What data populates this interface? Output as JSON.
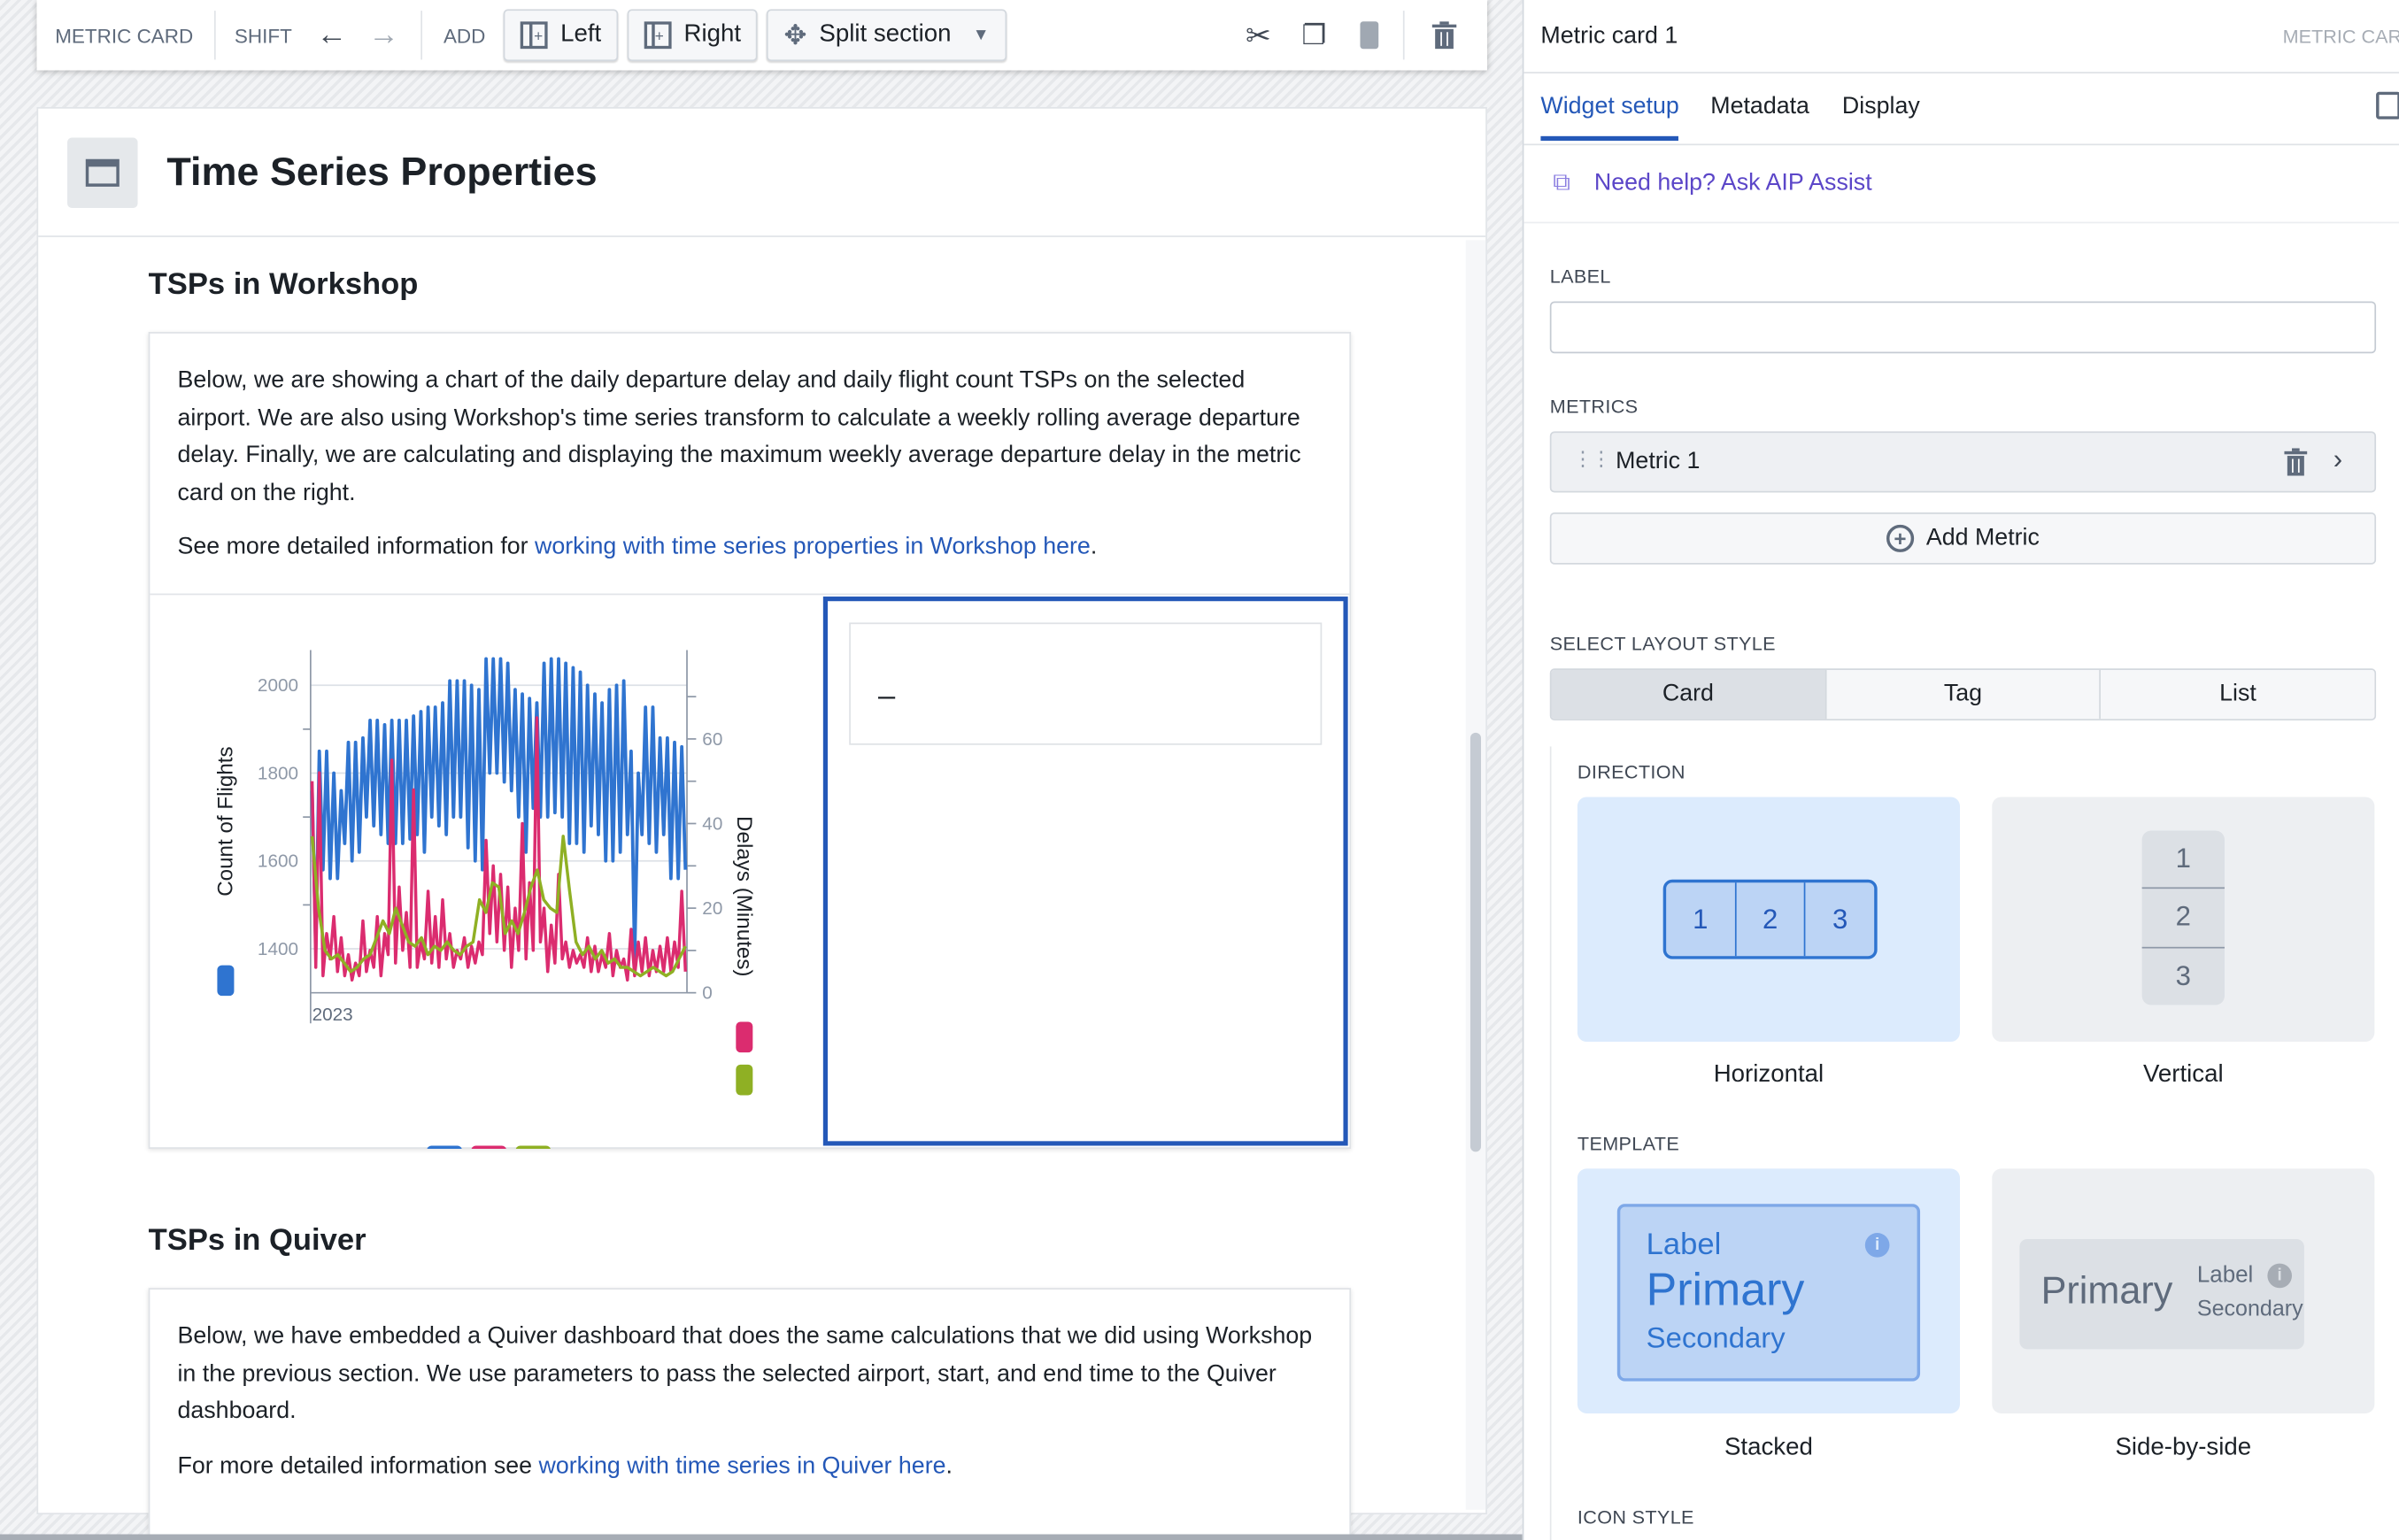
{
  "toolbar": {
    "widget_type": "METRIC CARD",
    "shift_label": "SHIFT",
    "add_label": "ADD",
    "left_label": "Left",
    "right_label": "Right",
    "split_label": "Split section",
    "icons": [
      "arrow-left-icon",
      "arrow-right-icon",
      "cut-icon",
      "duplicate-icon",
      "clipboard-icon",
      "trash-icon"
    ]
  },
  "page": {
    "title": "Time Series Properties"
  },
  "section1": {
    "heading": "TSPs in Workshop",
    "p1": "Below, we are showing a chart of the daily departure delay and daily flight count TSPs on the selected airport. We are also using Workshop's time series transform to calculate a weekly rolling average departure delay. Finally, we are calculating and displaying the maximum weekly average departure delay in the metric card on the right.",
    "p2_prefix": "See more detailed information for ",
    "p2_link": "working with time series properties in Workshop here",
    "p2_suffix": ".",
    "metric_value": "–"
  },
  "section2": {
    "heading": "TSPs in Quiver",
    "p1": "Below, we have embedded a Quiver dashboard that does the same calculations that we did using Workshop in the previous section. We use parameters to pass the selected airport, start, and end time to the Quiver dashboard.",
    "p2_prefix": "For more detailed information see ",
    "p2_link": "working with time series in Quiver here",
    "p2_suffix": "."
  },
  "chart_data": {
    "type": "line",
    "x_label": "2023",
    "ylabel": "Count of Flights",
    "ylim": [
      1300,
      2080
    ],
    "yticks": [
      1400,
      1600,
      1800,
      2000
    ],
    "y2label": "Delays (Minutes)",
    "y2lim": [
      0,
      81
    ],
    "y2ticks": [
      0,
      20,
      40,
      60
    ],
    "grid": true,
    "legend": "bottom",
    "series": [
      {
        "axis": "left",
        "color": "#2f74d0",
        "values": [
          1760,
          1400,
          1850,
          1580,
          1850,
          1560,
          1800,
          1560,
          1760,
          1640,
          1870,
          1600,
          1870,
          1620,
          1880,
          1700,
          1920,
          1680,
          1920,
          1660,
          1910,
          1640,
          1920,
          1640,
          1920,
          1640,
          1920,
          1650,
          1930,
          1660,
          1940,
          1620,
          1950,
          1700,
          1950,
          1680,
          1960,
          1660,
          2010,
          1700,
          2010,
          1700,
          2010,
          1630,
          2000,
          1600,
          1990,
          1580,
          2060,
          1800,
          2060,
          1800,
          2060,
          1780,
          2050,
          1760,
          1990,
          1700,
          1980,
          1620,
          1970,
          1720,
          1960,
          1700,
          2050,
          1700,
          2060,
          1710,
          2060,
          1700,
          2050,
          1640,
          2040,
          1640,
          2030,
          1620,
          2000,
          1680,
          1980,
          1660,
          1960,
          1600,
          1990,
          1600,
          2000,
          1620,
          2010,
          1660,
          1850,
          1380,
          1800,
          1660,
          1950,
          1640,
          1950,
          1620,
          1880,
          1660,
          1880,
          1560,
          1870,
          1560,
          1860,
          1580
        ]
      },
      {
        "axis": "right",
        "color": "#db2c6f",
        "values": [
          50,
          6,
          52,
          4,
          14,
          8,
          18,
          5,
          13,
          4,
          9,
          3,
          7,
          4,
          17,
          5,
          10,
          6,
          18,
          4,
          14,
          9,
          55,
          7,
          25,
          10,
          19,
          6,
          48,
          6,
          12,
          8,
          24,
          7,
          18,
          6,
          22,
          8,
          14,
          6,
          10,
          8,
          13,
          6,
          11,
          7,
          12,
          9,
          36,
          14,
          30,
          12,
          28,
          10,
          25,
          6,
          20,
          10,
          40,
          8,
          26,
          10,
          65,
          12,
          20,
          5,
          16,
          7,
          28,
          8,
          12,
          6,
          10,
          7,
          9,
          6,
          13,
          5,
          11,
          5,
          9,
          6,
          14,
          4,
          10,
          6,
          8,
          3,
          15,
          4,
          12,
          5,
          13,
          4,
          10,
          5,
          11,
          5,
          13,
          5,
          12,
          6,
          24,
          5
        ]
      },
      {
        "axis": "right",
        "color": "#8fb024",
        "values": [
          37,
          20,
          10,
          8,
          9,
          7,
          5,
          6,
          8,
          9,
          13,
          17,
          14,
          20,
          16,
          12,
          11,
          13,
          9,
          11,
          10,
          12,
          10,
          9,
          11,
          12,
          22,
          19,
          26,
          25,
          14,
          17,
          14,
          19,
          25,
          29,
          22,
          20,
          19,
          37,
          24,
          12,
          9,
          11,
          8,
          10,
          7,
          8,
          6,
          6,
          5,
          4,
          5,
          6,
          5,
          4,
          5,
          8,
          11
        ]
      }
    ]
  },
  "panel": {
    "title": "Metric card 1",
    "type_label": "METRIC CARD",
    "tabs": [
      {
        "label": "Widget setup",
        "active": true
      },
      {
        "label": "Metadata"
      },
      {
        "label": "Display"
      }
    ],
    "aip_help": "Need help? Ask AIP Assist",
    "label_caption": "LABEL",
    "label_value": "",
    "metrics_caption": "METRICS",
    "metric_name": "Metric 1",
    "add_metric": "Add Metric",
    "layout_caption": "SELECT LAYOUT STYLE",
    "layout_options": [
      "Card",
      "Tag",
      "List"
    ],
    "layout_selected": "Card",
    "direction_caption": "DIRECTION",
    "direction_horizontal": "Horizontal",
    "direction_vertical": "Vertical",
    "direction_selected": "Horizontal",
    "numbers": [
      "1",
      "2",
      "3"
    ],
    "template_caption": "TEMPLATE",
    "template_stacked": "Stacked",
    "template_side": "Side-by-side",
    "template_selected": "Stacked",
    "sample_label": "Label",
    "sample_primary": "Primary",
    "sample_secondary": "Secondary",
    "icon_style_caption": "ICON STYLE"
  }
}
